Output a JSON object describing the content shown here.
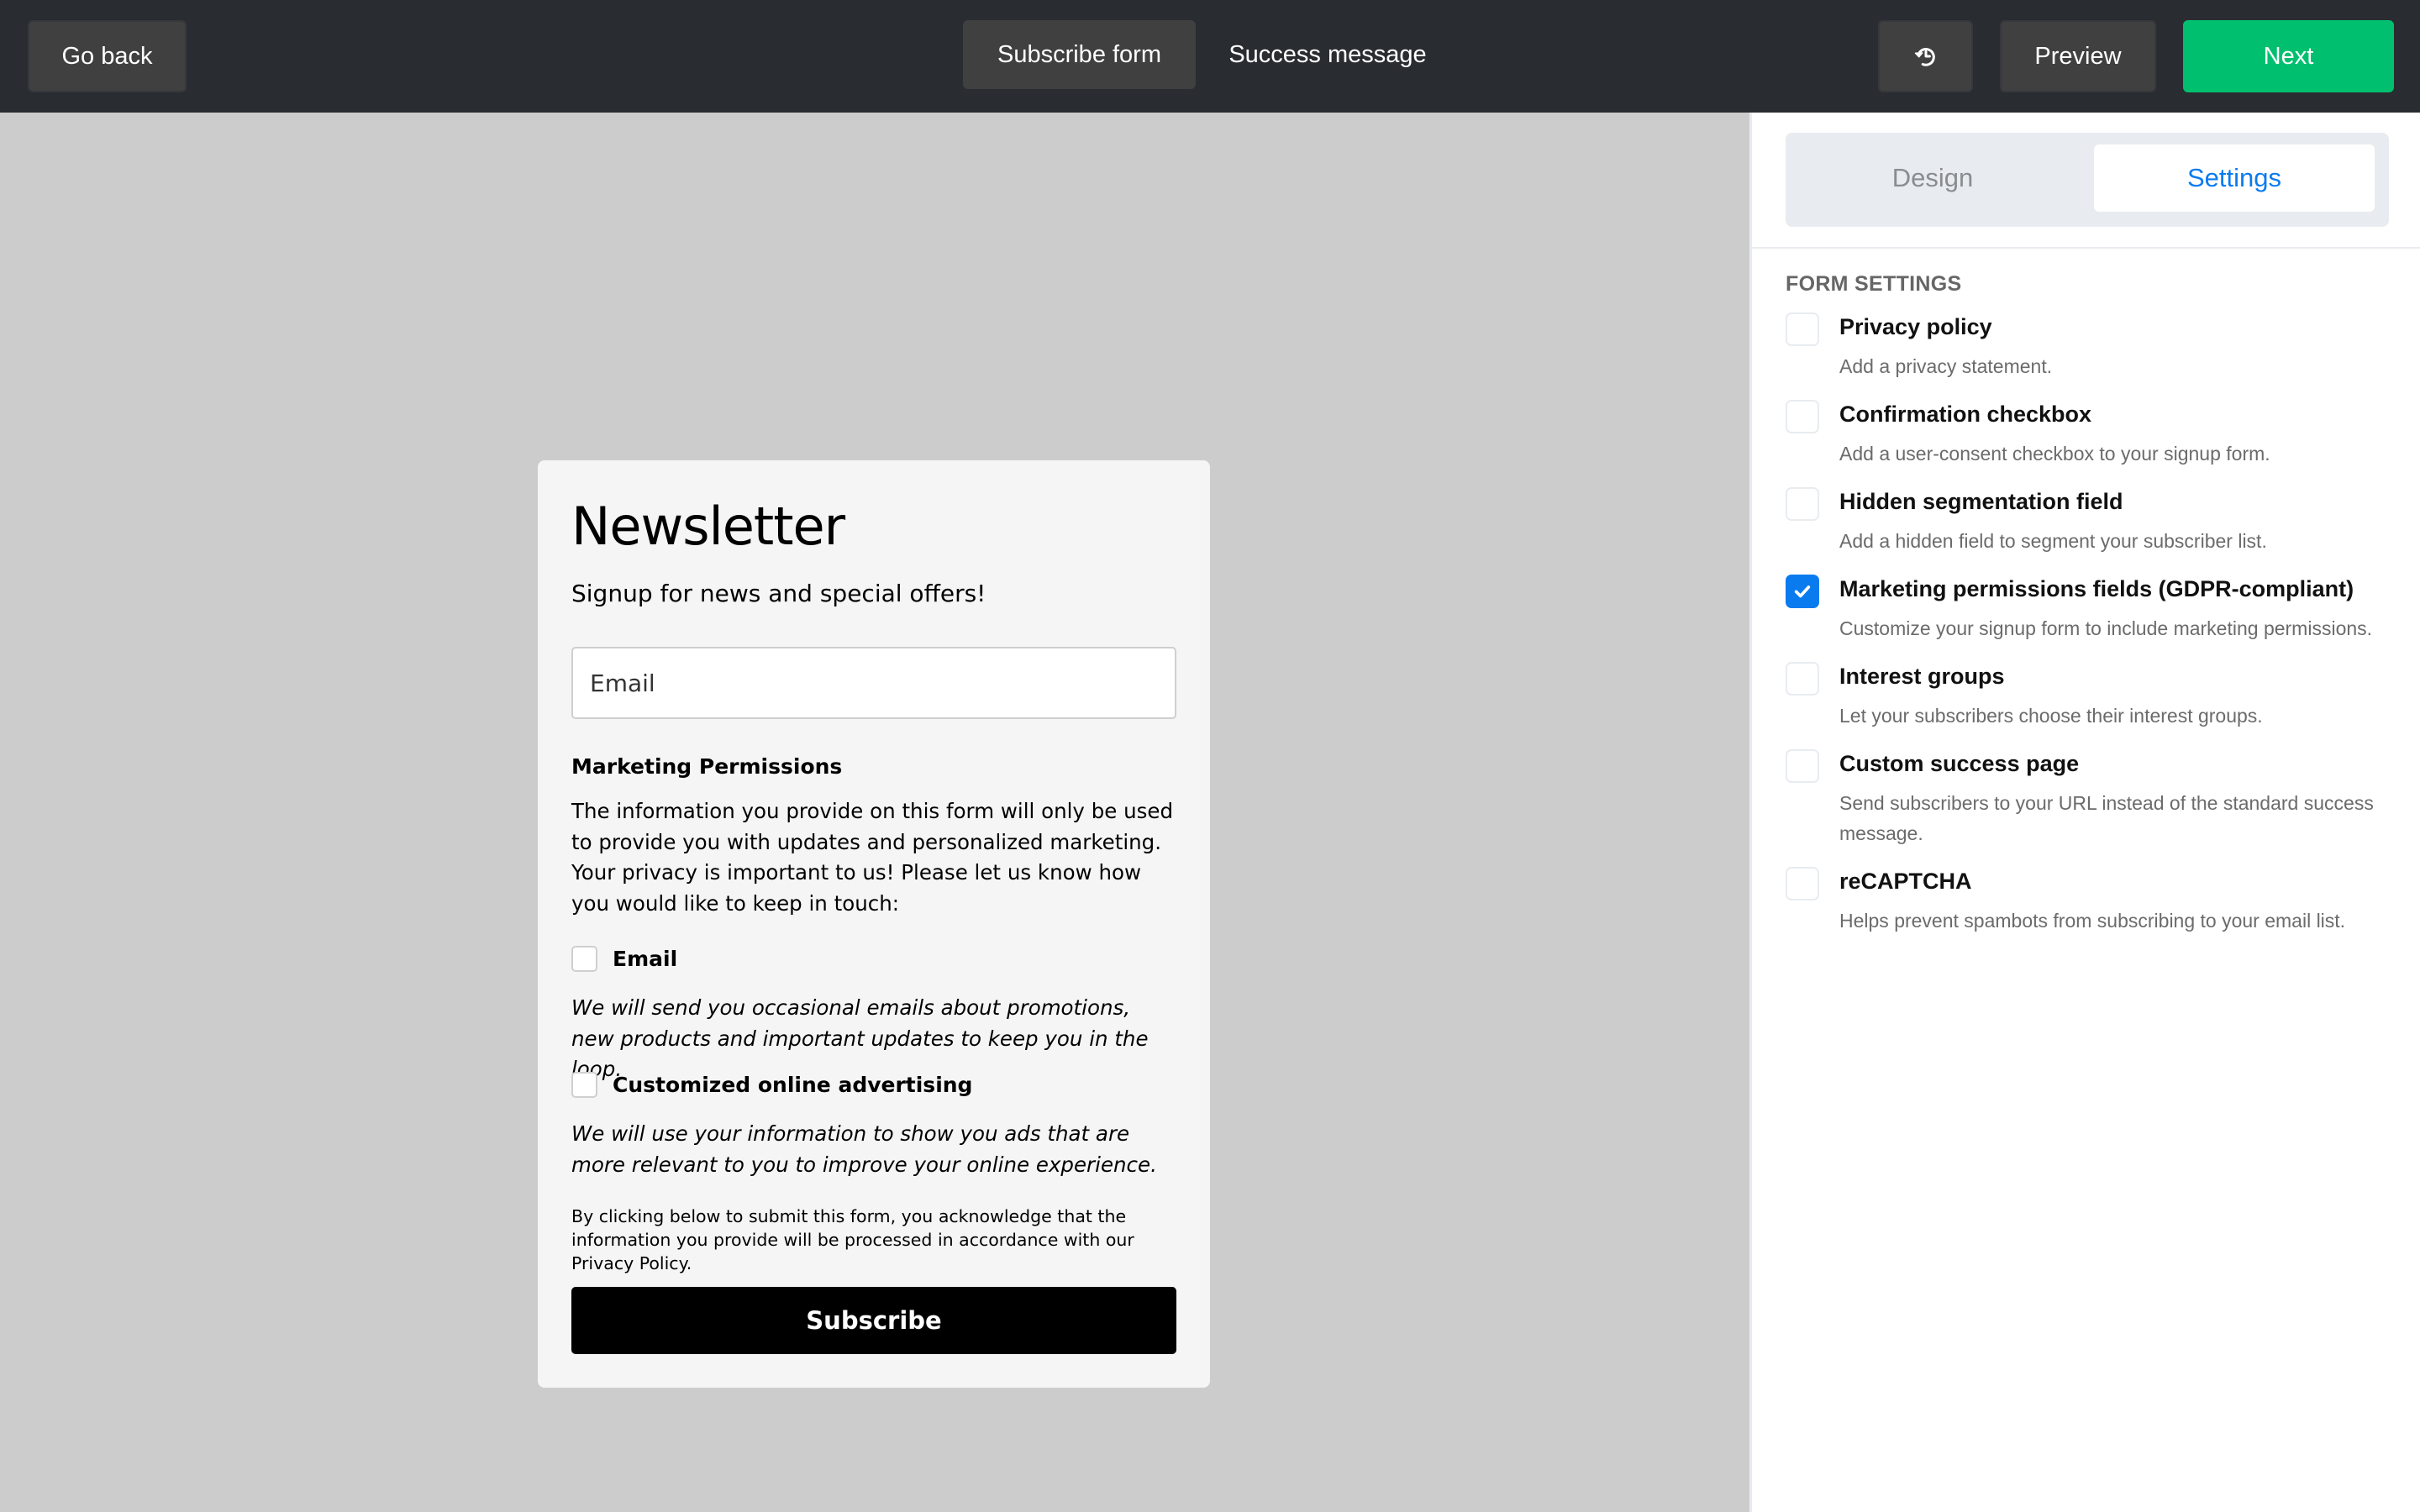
{
  "topbar": {
    "go_back_label": "Go back",
    "tabs": [
      {
        "label": "Subscribe form",
        "active": true
      },
      {
        "label": "Success message",
        "active": false
      }
    ],
    "history_icon": "history-icon",
    "preview_label": "Preview",
    "next_label": "Next"
  },
  "form": {
    "title": "Newsletter",
    "subtitle": "Signup for news and special offers!",
    "email_placeholder": "Email",
    "marketing_heading": "Marketing Permissions",
    "marketing_description": "The information you provide on this form will only be used to provide you with updates and personalized marketing. Your privacy is important to us! Please let us know how you would like to keep in touch:",
    "permissions": [
      {
        "label": "Email",
        "checked": false,
        "note": "We will send you occasional emails about promotions, new products and important updates to keep you in the loop."
      },
      {
        "label": "Customized online advertising",
        "checked": false,
        "note": "We will use your information to show you ads that are more relevant to you to improve your online experience."
      }
    ],
    "legal_text": "By clicking below to submit this form, you acknowledge that the information you provide will be processed in accordance with our Privacy Policy.",
    "submit_label": "Subscribe"
  },
  "panel": {
    "tabs": [
      {
        "label": "Design",
        "active": false
      },
      {
        "label": "Settings",
        "active": true
      }
    ],
    "section_heading": "FORM SETTINGS",
    "options": [
      {
        "title": "Privacy policy",
        "description": "Add a privacy statement.",
        "checked": false
      },
      {
        "title": "Confirmation checkbox",
        "description": "Add a user-consent checkbox to your signup form.",
        "checked": false
      },
      {
        "title": "Hidden segmentation field",
        "description": "Add a hidden field to segment your subscriber list.",
        "checked": false
      },
      {
        "title": "Marketing permissions fields (GDPR-compliant)",
        "description": "Customize your signup form to include marketing permissions.",
        "checked": true
      },
      {
        "title": "Interest groups",
        "description": "Let your subscribers choose their interest groups.",
        "checked": false
      },
      {
        "title": "Custom success page",
        "description": "Send subscribers to your URL instead of the standard success message.",
        "checked": false
      },
      {
        "title": "reCAPTCHA",
        "description": "Helps prevent spambots from subscribing to your email list.",
        "checked": false
      }
    ]
  },
  "colors": {
    "topbar_bg": "#292c31",
    "accent_green": "#00c06f",
    "accent_blue": "#0a7bef",
    "canvas_bg": "#cccccc"
  }
}
